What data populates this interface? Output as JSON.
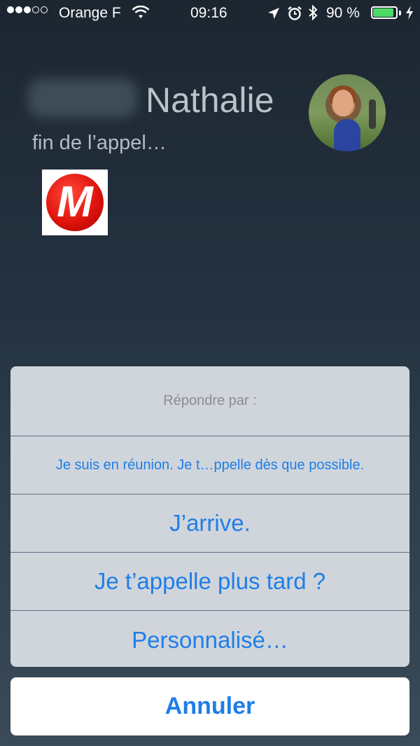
{
  "status_bar": {
    "signal_dots": [
      true,
      true,
      true,
      false,
      false
    ],
    "carrier": "Orange F",
    "time": "09:16",
    "battery_percent": "90 %",
    "battery_level": 0.9,
    "icons": [
      "wifi-icon",
      "location-arrow-icon",
      "alarm-icon",
      "bluetooth-icon",
      "battery-icon",
      "charging-bolt-icon"
    ]
  },
  "call": {
    "caller_name": "Nathalie",
    "status": "fin de l’appel…"
  },
  "app_icon": {
    "letter": "M",
    "color": "#e0140c"
  },
  "action_sheet": {
    "title": "Répondre par :",
    "options": [
      "Je suis en réunion. Je t…ppelle dès que possible.",
      "J’arrive.",
      "Je t’appelle plus tard ?",
      "Personnalisé…"
    ],
    "cancel_label": "Annuler"
  },
  "colors": {
    "accent": "#1f7ee8",
    "battery": "#4cd964"
  }
}
